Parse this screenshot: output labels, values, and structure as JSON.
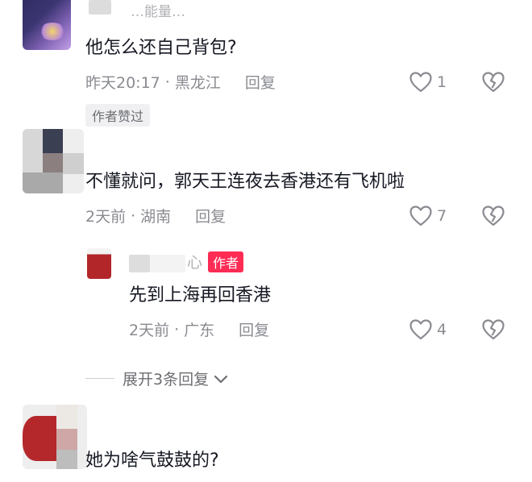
{
  "comments": [
    {
      "username_partial": "…能量…",
      "text": "他怎么还自己背包?",
      "time": "昨天20:17",
      "location": "黑龙江",
      "reply_label": "回复",
      "likes": "1",
      "badge": "作者赞过"
    },
    {
      "text": "不懂就问，郭天王连夜去香港还有飞机啦",
      "time": "2天前",
      "location": "湖南",
      "reply_label": "回复",
      "likes": "7",
      "replies": [
        {
          "username_partial": "心",
          "badge": "作者",
          "text": "先到上海再回香港",
          "time": "2天前",
          "location": "广东",
          "reply_label": "回复",
          "likes": "4"
        }
      ],
      "expand_label": "展开3条回复"
    },
    {
      "text": "她为啥气鼓鼓的?"
    }
  ],
  "icons": {
    "like": "heart-outline-icon",
    "dislike": "broken-heart-icon",
    "expand": "chevron-down-icon"
  },
  "colors": {
    "text": "#161823",
    "meta": "#8a8b91",
    "author_badge": "#fe2c55"
  }
}
